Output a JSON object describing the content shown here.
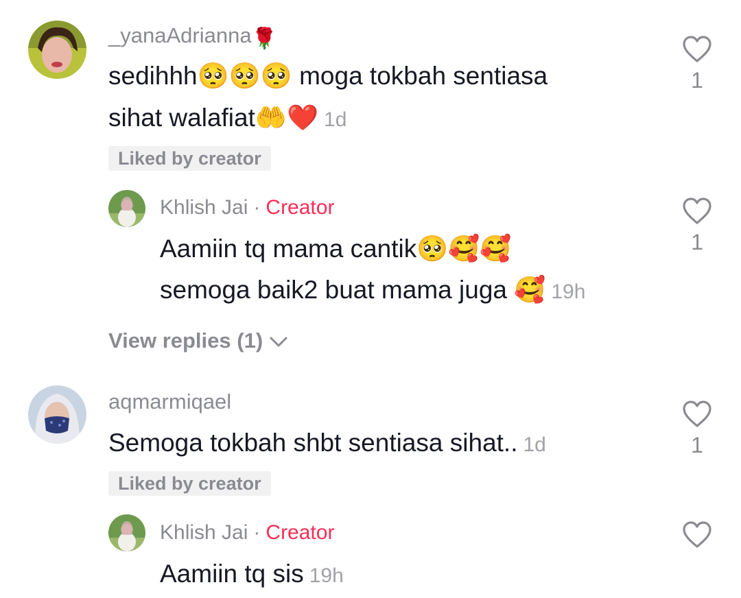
{
  "comments": [
    {
      "username": "_yanaAdrianna",
      "username_emoji": "🌹",
      "line1": "sedihhh🥺🥺🥺 moga tokbah sentiasa",
      "line2": "sihat walafiat🤲❤️",
      "time": "1d",
      "liked_by_creator": "Liked by creator",
      "likes": "1",
      "reply": {
        "name": "Khlish Jai",
        "separator": "·",
        "badge": "Creator",
        "line1": "Aamiin tq mama cantik🥺🥰🥰",
        "line2": "semoga baik2 buat mama juga 🥰",
        "time": "19h",
        "likes": "1"
      },
      "view_replies": "View replies (1)"
    },
    {
      "username": "aqmarmiqael",
      "line1": "Semoga tokbah shbt sentiasa sihat..",
      "time": "1d",
      "liked_by_creator": "Liked by creator",
      "likes": "1",
      "reply": {
        "name": "Khlish Jai",
        "separator": "·",
        "badge": "Creator",
        "line1": "Aamiin tq sis",
        "time": "19h"
      }
    }
  ],
  "icons": {
    "like": "heart-outline-icon",
    "expand": "chevron-down-icon"
  },
  "colors": {
    "creator_badge": "#fe2c55",
    "secondary_text": "#8a8b91",
    "pill_bg": "#f1f1f2"
  }
}
